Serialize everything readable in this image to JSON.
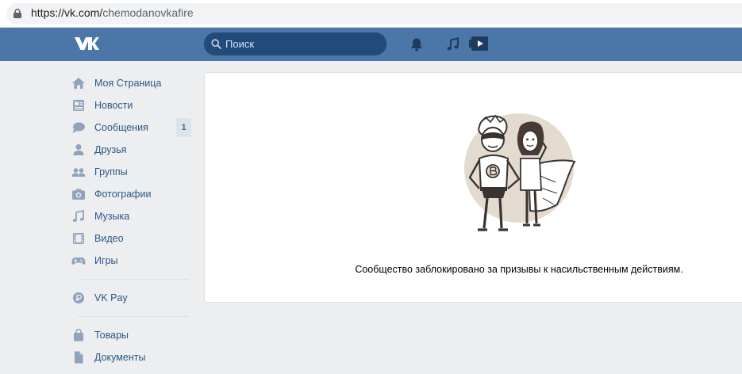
{
  "browser": {
    "url_host": "https://vk.com/",
    "url_path": "chemodanovkafire"
  },
  "header": {
    "logo": "vk-logo",
    "search_placeholder": "Поиск",
    "icons": [
      "bell-icon",
      "music-icon",
      "video-icon"
    ],
    "brand_color": "#4a76a8"
  },
  "sidebar": {
    "items": [
      {
        "label": "Моя Страница",
        "icon": "home-icon"
      },
      {
        "label": "Новости",
        "icon": "news-icon"
      },
      {
        "label": "Сообщения",
        "icon": "messages-icon",
        "badge": "1"
      },
      {
        "label": "Друзья",
        "icon": "friends-icon"
      },
      {
        "label": "Группы",
        "icon": "groups-icon"
      },
      {
        "label": "Фотографии",
        "icon": "camera-icon"
      },
      {
        "label": "Музыка",
        "icon": "music-note-icon"
      },
      {
        "label": "Видео",
        "icon": "film-icon"
      },
      {
        "label": "Игры",
        "icon": "gamepad-icon"
      }
    ],
    "vkpay": {
      "label": "VK Pay",
      "icon": "vkpay-icon"
    },
    "extra": [
      {
        "label": "Товары",
        "icon": "bag-icon"
      },
      {
        "label": "Документы",
        "icon": "document-icon"
      }
    ]
  },
  "main": {
    "illustration": "blocked-superheroes-illustration",
    "message": "Сообщество заблокировано за призывы к насильственным действиям."
  }
}
